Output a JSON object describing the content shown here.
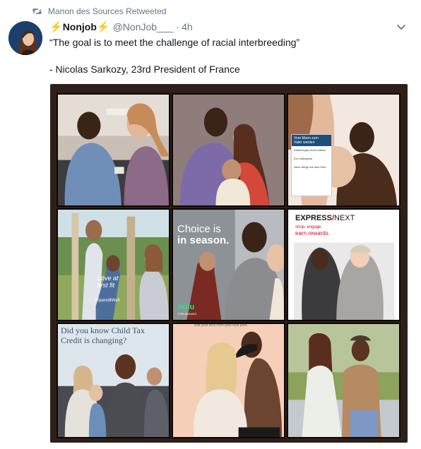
{
  "retweet": {
    "text": "Manon des Sources Retweeted",
    "icon": "retweet-icon"
  },
  "author": {
    "bolt": "⚡",
    "display_name": "Nonjob",
    "handle": "@NonJob___",
    "separator": "·",
    "time": "4h",
    "avatar": "avatar"
  },
  "menu": {
    "icon": "chevron-down-icon"
  },
  "tweet": {
    "line1": "“The goal is to meet the challenge of racial interbreeding”",
    "line2": "- Nicolas Sarkozy, 23rd President of France"
  },
  "media": {
    "ad_mid_left": {
      "overlay_line1": "Love at",
      "overlay_line2": "first fit",
      "hashtag": "#SpenditWell"
    },
    "ad_center": {
      "headline_line1": "Choice is",
      "headline_line2": "in season.",
      "brand": "hulu",
      "brand_sub": "FOR BRANDS"
    },
    "ad_mid_right": {
      "brand": "EXPRESS",
      "slash": "/",
      "brand2": "NEXT",
      "tag1": "shop. engage.",
      "tag2": "earn rewards."
    },
    "ad_bottom_left": {
      "line1": "Did you know Child Tax",
      "line2": "Credit is changing?"
    },
    "ad_bottom_center": {
      "caption": "Ask your tech from your new print."
    },
    "ad_top_right": {
      "title_line1": "Vom Mann zum",
      "title_line2": "Vater werden",
      "body1": "Erfahrungen eines Vaters",
      "body2": "Zur Vatergeste",
      "body3": "Neue Wege mit dem Kind"
    }
  },
  "colors": {
    "accent_bolt": "#f5b400",
    "muted": "#657786",
    "frame": "#2e2019"
  }
}
